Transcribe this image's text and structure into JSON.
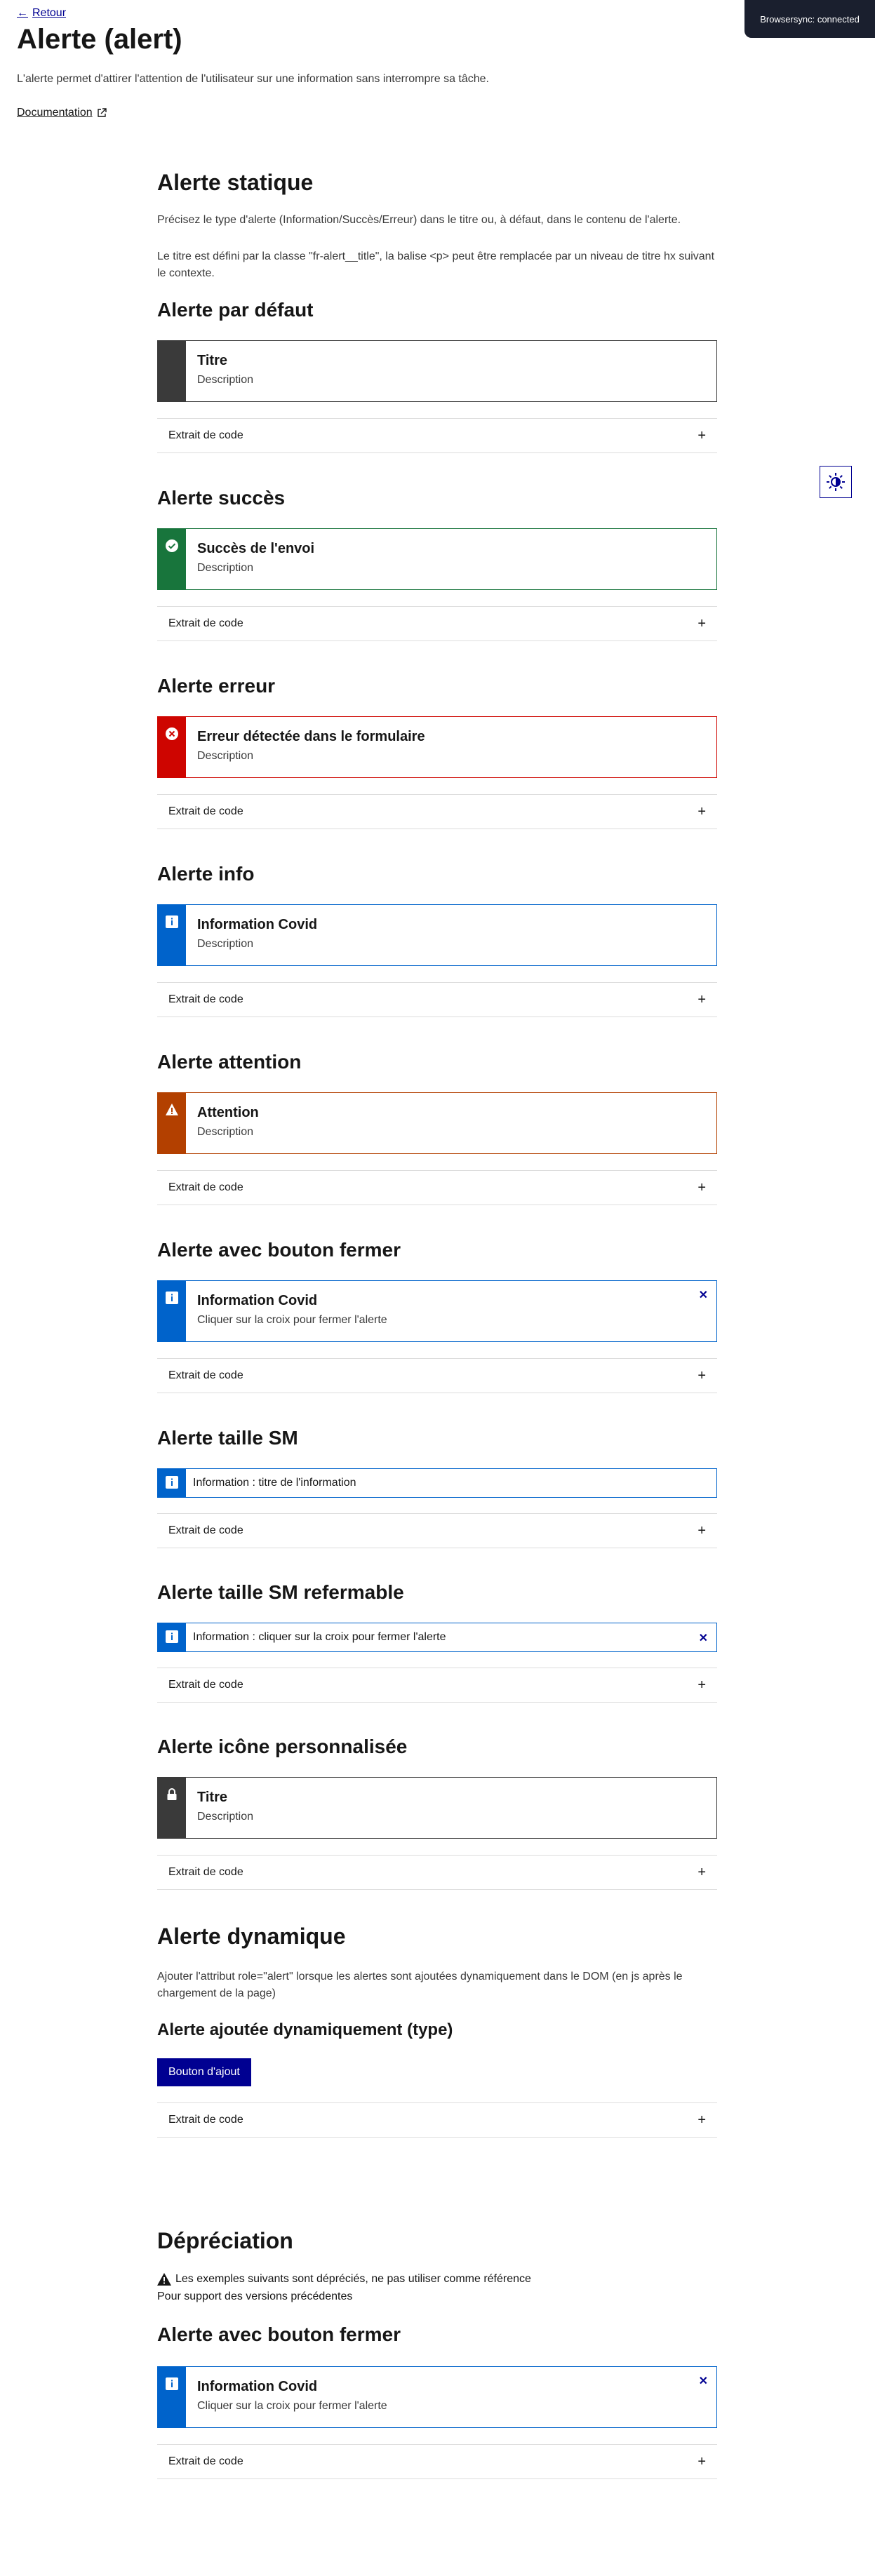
{
  "header": {
    "back_label": "Retour",
    "title": "Alerte (alert)",
    "description": "L'alerte permet d'attirer l'attention de l'utilisateur sur une information sans interrompre sa tâche.",
    "doc_label": "Documentation"
  },
  "browsersync": "Browsersync: connected",
  "static_section": {
    "title": "Alerte statique",
    "text1": "Précisez le type d'alerte (Information/Succès/Erreur) dans le titre ou, à défaut, dans le contenu de l'alerte.",
    "text2": "Le titre est défini par la classe \"fr-alert__title\", la balise <p> peut être remplacée par un niveau de titre hx suivant le contexte."
  },
  "code_label": "Extrait de code",
  "alerts": {
    "default": {
      "heading": "Alerte par défaut",
      "title": "Titre",
      "desc": "Description"
    },
    "success": {
      "heading": "Alerte succès",
      "title": "Succès de l'envoi",
      "desc": "Description"
    },
    "error": {
      "heading": "Alerte erreur",
      "title": "Erreur détectée dans le formulaire",
      "desc": "Description"
    },
    "info": {
      "heading": "Alerte info",
      "title": "Information Covid",
      "desc": "Description"
    },
    "warning": {
      "heading": "Alerte attention",
      "title": "Attention",
      "desc": "Description"
    },
    "closable": {
      "heading": "Alerte avec bouton fermer",
      "title": "Information Covid",
      "desc": "Cliquer sur la croix pour fermer l'alerte"
    },
    "sm": {
      "heading": "Alerte taille SM",
      "text": "Information : titre de l'information"
    },
    "sm_closable": {
      "heading": "Alerte taille SM refermable",
      "text": "Information : cliquer sur la croix pour fermer l'alerte"
    },
    "custom_icon": {
      "heading": "Alerte icône personnalisée",
      "title": "Titre",
      "desc": "Description"
    }
  },
  "dynamic": {
    "title": "Alerte dynamique",
    "text": "Ajouter l'attribut role=\"alert\" lorsque les alertes sont ajoutées dynamiquement dans le DOM (en js après le chargement de la page)",
    "subtitle": "Alerte ajoutée dynamiquement (type)",
    "button": "Bouton d'ajout"
  },
  "deprecation": {
    "title": "Dépréciation",
    "warning": "Les exemples suivants sont dépréciés, ne pas utiliser comme référence",
    "support": "Pour support des versions précédentes",
    "subtitle": "Alerte avec bouton fermer",
    "alert_title": "Information Covid",
    "alert_desc": "Cliquer sur la croix pour fermer l'alerte"
  },
  "colors": {
    "default": "#3a3a3a",
    "success": "#18753c",
    "error": "#ce0500",
    "info": "#0063cb",
    "warning": "#b34000",
    "primary": "#000091"
  }
}
